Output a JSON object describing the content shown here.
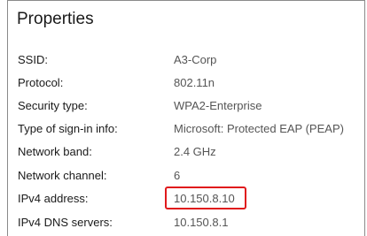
{
  "panel": {
    "title": "Properties"
  },
  "properties": [
    {
      "label": "SSID:",
      "value": "A3-Corp"
    },
    {
      "label": "Protocol:",
      "value": "802.11n"
    },
    {
      "label": "Security type:",
      "value": "WPA2-Enterprise"
    },
    {
      "label": "Type of sign-in info:",
      "value": "Microsoft: Protected EAP (PEAP)"
    },
    {
      "label": "Network band:",
      "value": "2.4 GHz"
    },
    {
      "label": "Network channel:",
      "value": "6"
    },
    {
      "label": "IPv4 address:",
      "value": "10.150.8.10"
    },
    {
      "label": "IPv4 DNS servers:",
      "value": "10.150.8.1"
    }
  ],
  "highlight": {
    "target": "IPv4 address",
    "color": "#e0191c"
  }
}
